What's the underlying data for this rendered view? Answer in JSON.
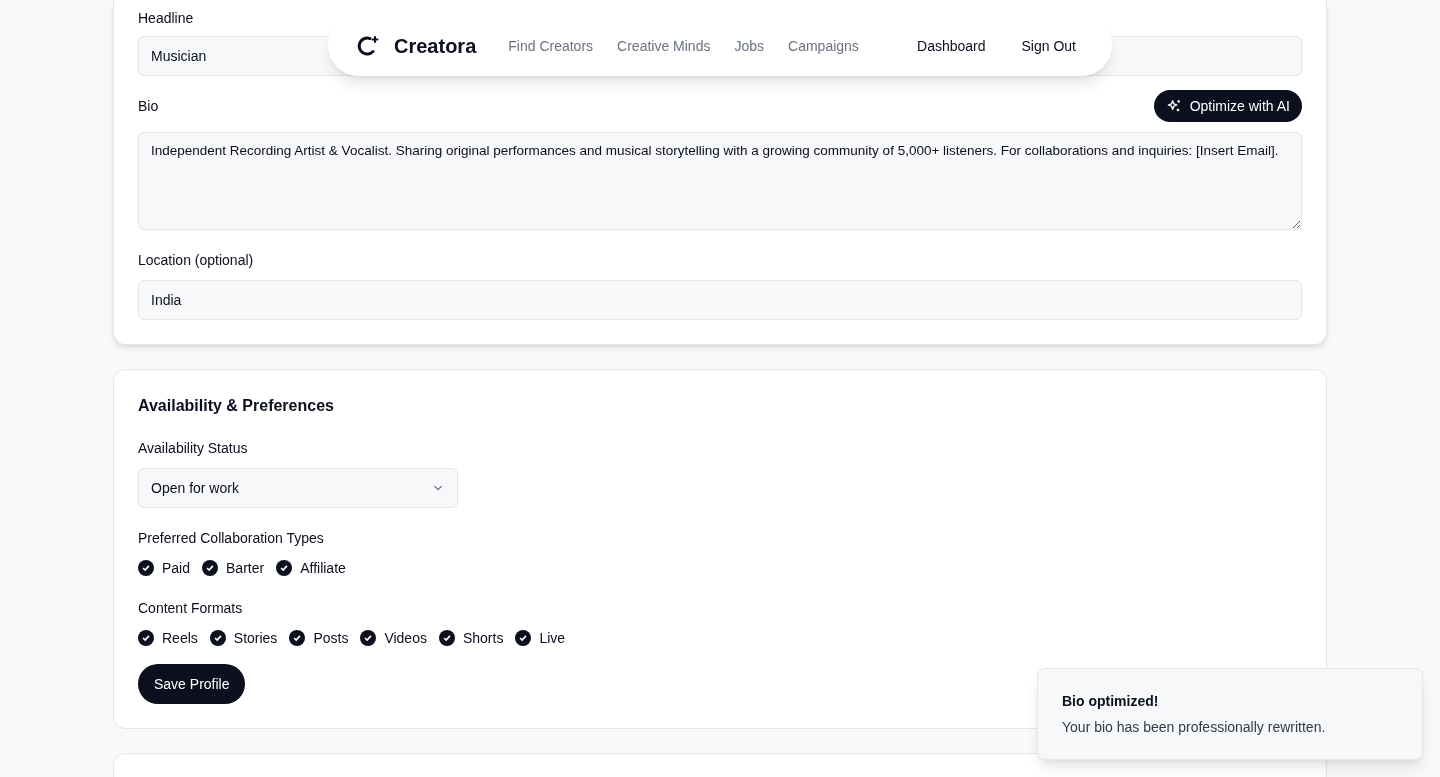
{
  "nav": {
    "brand": "Creatora",
    "links": [
      {
        "label": "Find Creators"
      },
      {
        "label": "Creative Minds"
      },
      {
        "label": "Jobs"
      },
      {
        "label": "Campaigns"
      }
    ],
    "actions": [
      {
        "label": "Dashboard"
      },
      {
        "label": "Sign Out"
      }
    ]
  },
  "profile": {
    "headline": {
      "label": "Headline",
      "value": "Musician"
    },
    "bio": {
      "label": "Bio",
      "button": "Optimize with AI",
      "value": "Independent Recording Artist & Vocalist. Sharing original performances and musical storytelling with a growing community of 5,000+ listeners. For collaborations and inquiries: [Insert Email]."
    },
    "location": {
      "label": "Location (optional)",
      "value": "India"
    }
  },
  "availability": {
    "title": "Availability & Preferences",
    "status": {
      "label": "Availability Status",
      "value": "Open for work"
    },
    "collaboration": {
      "label": "Preferred Collaboration Types",
      "options": [
        {
          "label": "Paid",
          "checked": true
        },
        {
          "label": "Barter",
          "checked": true
        },
        {
          "label": "Affiliate",
          "checked": true
        }
      ]
    },
    "formats": {
      "label": "Content Formats",
      "options": [
        {
          "label": "Reels",
          "checked": true
        },
        {
          "label": "Stories",
          "checked": true
        },
        {
          "label": "Posts",
          "checked": true
        },
        {
          "label": "Videos",
          "checked": true
        },
        {
          "label": "Shorts",
          "checked": true
        },
        {
          "label": "Live",
          "checked": true
        }
      ]
    },
    "save": "Save Profile"
  },
  "toast": {
    "title": "Bio optimized!",
    "message": "Your bio has been professionally rewritten."
  }
}
